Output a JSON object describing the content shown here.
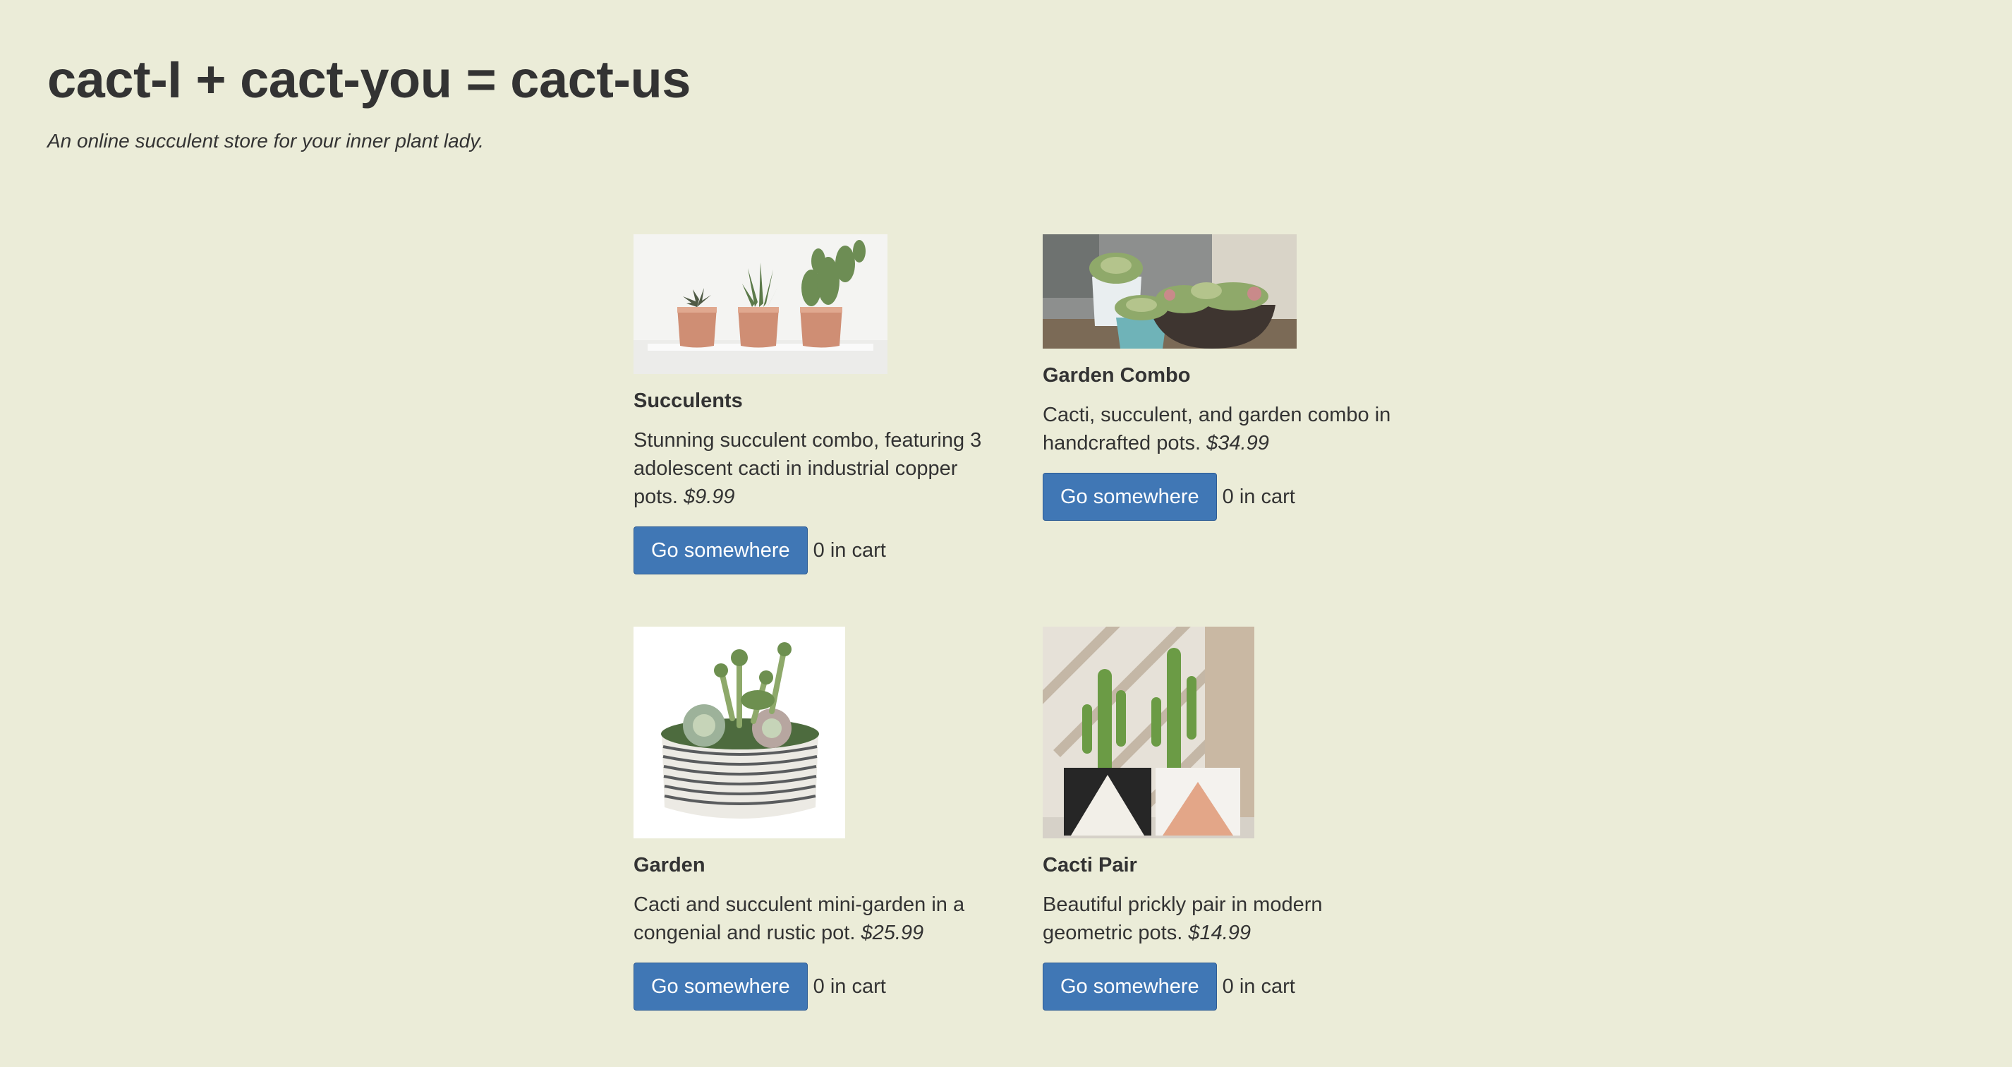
{
  "header": {
    "title": "cact-I + cact-you = cact-us",
    "tagline": "An online succulent store for your inner plant lady."
  },
  "products": [
    {
      "name": "Succulents",
      "description": "Stunning succulent combo, featuring 3 adolescent cacti in industrial copper pots.",
      "price": "$9.99",
      "button_label": "Go somewhere",
      "cart_label": "0 in cart",
      "image_icon": "copper-pots-cacti-image"
    },
    {
      "name": "Garden Combo",
      "description": "Cacti, succulent, and garden combo in handcrafted pots.",
      "price": "$34.99",
      "button_label": "Go somewhere",
      "cart_label": "0 in cart",
      "image_icon": "garden-combo-image"
    },
    {
      "name": "Garden",
      "description": "Cacti and succulent mini-garden in a congenial and rustic pot.",
      "price": "$25.99",
      "button_label": "Go somewhere",
      "cart_label": "0 in cart",
      "image_icon": "mini-garden-bowl-image"
    },
    {
      "name": "Cacti Pair",
      "description": "Beautiful prickly pair in modern geometric pots.",
      "price": "$14.99",
      "button_label": "Go somewhere",
      "cart_label": "0 in cart",
      "image_icon": "cacti-pair-image"
    }
  ],
  "colors": {
    "background": "#ebecd8",
    "text": "#333333",
    "button": "#4077b5",
    "button_text": "#ffffff"
  }
}
